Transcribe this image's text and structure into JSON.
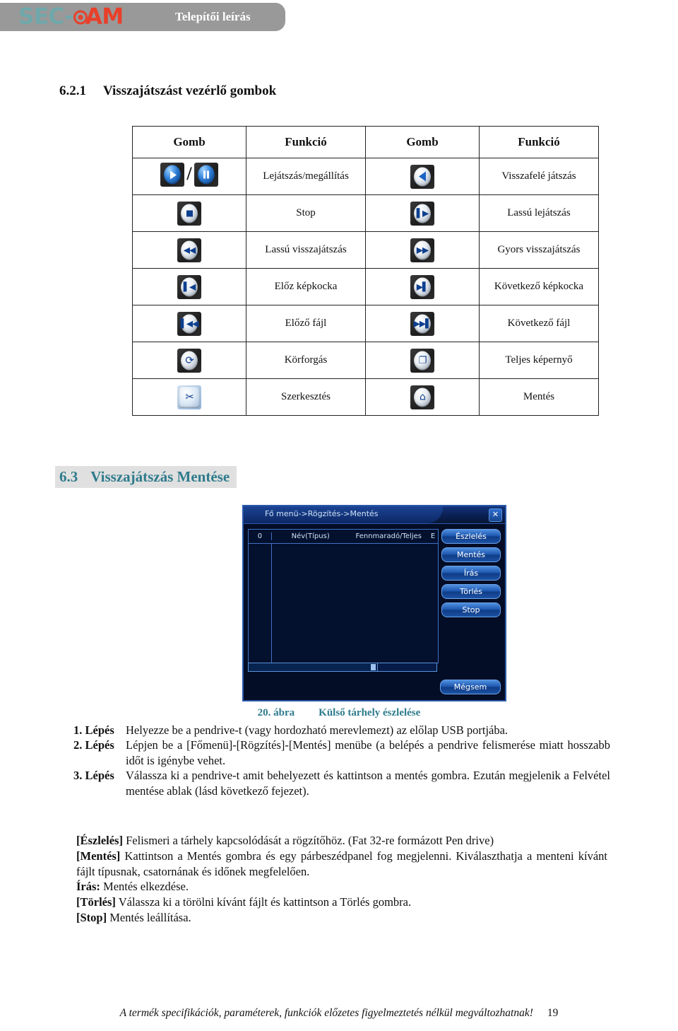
{
  "header": {
    "logo_sec": "SEC-",
    "logo_cam": "AM",
    "logo_icon": "target-icon",
    "title": "Telepítői leírás"
  },
  "section_621": {
    "number": "6.2.1",
    "title": "Visszajátszást vezérlő gombok"
  },
  "button_table": {
    "headers": [
      "Gomb",
      "Funkció",
      "Gomb",
      "Funkció"
    ],
    "rows": [
      {
        "left_icon": "play-pause-button-icon",
        "left_label": "Lejátszás/megállítás",
        "right_icon": "reverse-play-button-icon",
        "right_label": "Visszafelé játszás"
      },
      {
        "left_icon": "stop-button-icon",
        "left_label": "Stop",
        "right_icon": "slow-play-button-icon",
        "right_label": "Lassú lejátszás"
      },
      {
        "left_icon": "rewind-button-icon",
        "left_label": "Lassú visszajátszás",
        "right_icon": "fast-forward-button-icon",
        "right_label": "Gyors visszajátszás"
      },
      {
        "left_icon": "previous-frame-button-icon",
        "left_label": "Előz képkocka",
        "right_icon": "next-frame-button-icon",
        "right_label": "Következő képkocka"
      },
      {
        "left_icon": "previous-file-button-icon",
        "left_label": "Előző fájl",
        "right_icon": "next-file-button-icon",
        "right_label": "Következő fájl"
      },
      {
        "left_icon": "rotate-button-icon",
        "left_label": "Körforgás",
        "right_icon": "fullscreen-button-icon",
        "right_label": "Teljes képernyő"
      },
      {
        "left_icon": "scissors-edit-button-icon",
        "left_label": "Szerkesztés",
        "right_icon": "save-backup-button-icon",
        "right_label": "Mentés"
      }
    ]
  },
  "section_63": {
    "number": "6.3",
    "title": "Visszajátszás Mentése"
  },
  "dvr_dialog": {
    "title": "Fő menü->Rögzítés->Mentés",
    "close_label": "✕",
    "list_headers": [
      "0",
      "Név(Típus)",
      "Fennmaradó/Teljes",
      "E"
    ],
    "buttons": [
      "Észlelés",
      "Mentés",
      "Írás",
      "Törlés",
      "Stop"
    ],
    "cancel_button": "Mégsem"
  },
  "figure": {
    "number": "20. ábra",
    "caption": "Külső tárhely észlelése"
  },
  "steps": [
    {
      "label": "1. Lépés",
      "text": "Helyezze be a pendrive-t (vagy hordozható merevlemezt) az előlap USB portjába."
    },
    {
      "label": "2. Lépés",
      "text": "Lépjen be a [Főmenü]-[Rögzítés]-[Mentés] menübe (a belépés a pendrive felismerése miatt hosszabb időt is igénybe vehet."
    },
    {
      "label": "3. Lépés",
      "text": "Válassza ki a pendrive-t amit behelyezett és kattintson a mentés gombra. Ezután megjelenik a Felvétel mentése ablak (lásd következő fejezet)."
    }
  ],
  "notes": [
    {
      "term": "[Észlelés]",
      "text": " Felismeri a tárhely kapcsolódását a rögzítőhöz. (Fat 32-re formázott Pen drive)"
    },
    {
      "term": "[Mentés]",
      "text": " Kattintson a Mentés gombra és egy párbeszédpanel fog megjelenni. Kiválaszthatja a menteni kívánt fájlt típusnak, csatornának és időnek megfelelően."
    },
    {
      "term": "Írás:",
      "text": " Mentés elkezdése."
    },
    {
      "term": "[Törlés]",
      "text": " Válassza ki a törölni kívánt fájlt és kattintson a Törlés gombra."
    },
    {
      "term": "[Stop]",
      "text": " Mentés leállítása."
    }
  ],
  "footer": {
    "text": "A termék specifikációk, paraméterek, funkciók előzetes figyelmeztetés nélkül megváltozhatnak!",
    "page": "19"
  }
}
